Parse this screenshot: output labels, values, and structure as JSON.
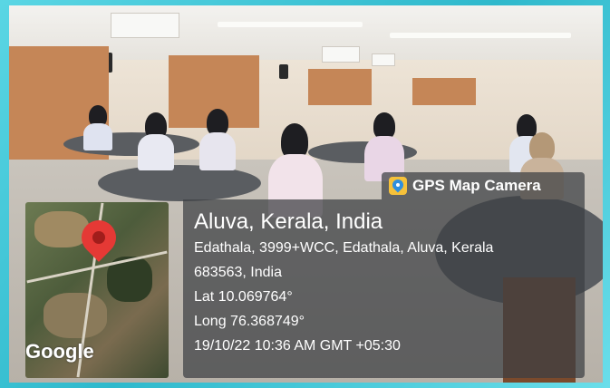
{
  "overlay": {
    "app_name": "GPS Map Camera",
    "location_title": "Aluva, Kerala, India",
    "address_line1": "Edathala, 3999+WCC, Edathala, Aluva, Kerala",
    "address_line2": "683563, India",
    "latitude": "Lat 10.069764°",
    "longitude": "Long 76.368749°",
    "datetime": "19/10/22 10:36 AM GMT +05:30"
  },
  "map": {
    "brand": "Google",
    "pin_color": "#e53935"
  },
  "photo": {
    "subject": "classroom with students seated at round tables"
  }
}
